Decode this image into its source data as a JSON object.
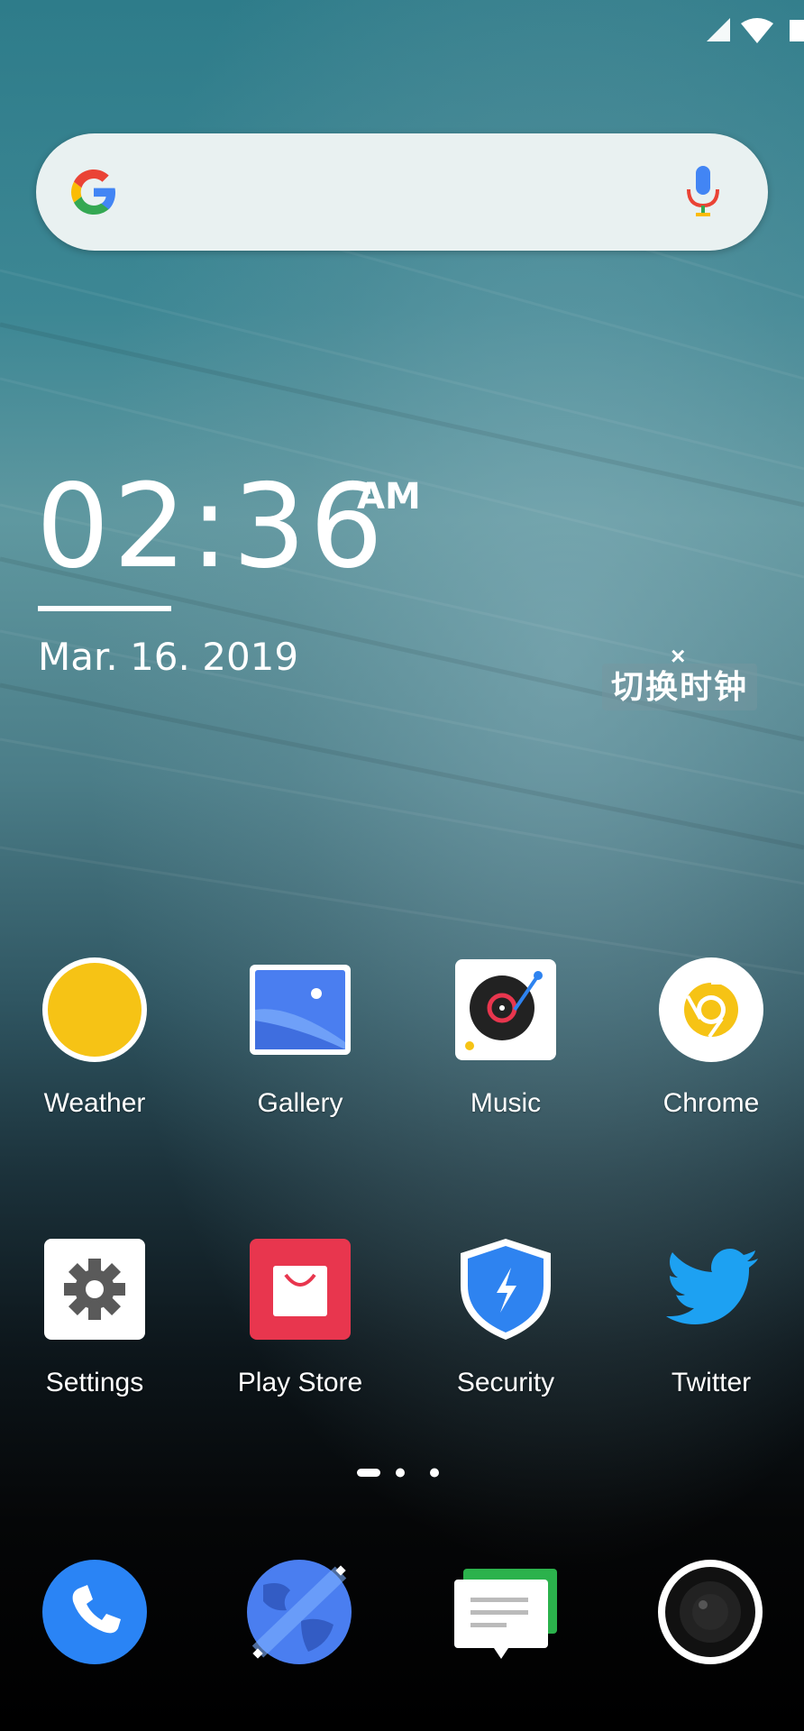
{
  "status_bar": {
    "icons": [
      "cellular-signal-icon",
      "wifi-icon",
      "battery-icon"
    ]
  },
  "search": {
    "logo": "G",
    "mic_icon": "mic-icon"
  },
  "clock": {
    "time": "02:36",
    "ampm": "AM",
    "date": "Mar. 16. 2019"
  },
  "clock_widget": {
    "switch_label": "切换时钟",
    "close_glyph": "×"
  },
  "apps_row1": [
    {
      "label": "Weather",
      "icon": "weather-icon"
    },
    {
      "label": "Gallery",
      "icon": "gallery-icon"
    },
    {
      "label": "Music",
      "icon": "music-icon"
    },
    {
      "label": "Chrome",
      "icon": "chrome-icon"
    }
  ],
  "apps_row2": [
    {
      "label": "Settings",
      "icon": "settings-icon"
    },
    {
      "label": "Play Store",
      "icon": "play-store-icon"
    },
    {
      "label": "Security",
      "icon": "security-icon"
    },
    {
      "label": "Twitter",
      "icon": "twitter-icon"
    }
  ],
  "page_indicator": {
    "pages": 3,
    "current": 1
  },
  "dock": [
    {
      "icon": "phone-icon"
    },
    {
      "icon": "browser-icon"
    },
    {
      "icon": "messages-icon"
    },
    {
      "icon": "camera-icon"
    }
  ],
  "colors": {
    "weather": "#f6c315",
    "gallery": "#4d80ef",
    "playstore": "#e8364e",
    "security": "#2e83f0",
    "twitter": "#1da1f2",
    "phone": "#2a84f5"
  }
}
